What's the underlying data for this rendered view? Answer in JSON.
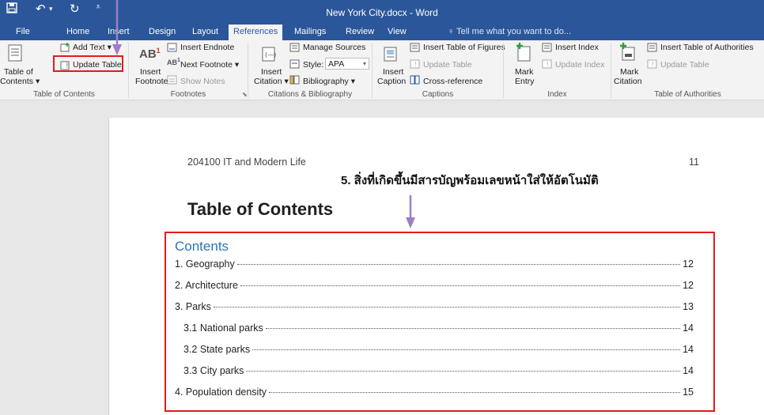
{
  "title_bar": {
    "doc_title": "New York City.docx - Word",
    "save_icon": "save-icon",
    "undo_icon": "undo-icon",
    "redo_icon": "redo-icon",
    "customize_icon": "customize-quick-access-icon"
  },
  "tabs": [
    {
      "label": "File"
    },
    {
      "label": "Home"
    },
    {
      "label": "Insert"
    },
    {
      "label": "Design"
    },
    {
      "label": "Layout"
    },
    {
      "label": "References",
      "active": true
    },
    {
      "label": "Mailings"
    },
    {
      "label": "Review"
    },
    {
      "label": "View"
    }
  ],
  "tell_me": {
    "placeholder": "Tell me what you want to do..."
  },
  "ribbon": {
    "toc": {
      "table_of_contents": "Table of",
      "table_of_contents_2": "Contents",
      "add_text": "Add Text",
      "update_table": "Update Table",
      "group_label": "Table of Contents"
    },
    "footnotes": {
      "insert_footnote": "Insert",
      "insert_footnote_2": "Footnote",
      "insert_endnote": "Insert Endnote",
      "next_footnote": "Next Footnote",
      "show_notes": "Show Notes",
      "group_label": "Footnotes"
    },
    "citations": {
      "insert_citation": "Insert",
      "insert_citation_2": "Citation",
      "manage_sources": "Manage Sources",
      "style_label": "Style:",
      "style_value": "APA",
      "bibliography": "Bibliography",
      "group_label": "Citations & Bibliography"
    },
    "captions": {
      "insert_caption": "Insert",
      "insert_caption_2": "Caption",
      "insert_table_of_figures": "Insert Table of Figures",
      "update_table": "Update Table",
      "cross_reference": "Cross-reference",
      "group_label": "Captions"
    },
    "index": {
      "mark_entry": "Mark",
      "mark_entry_2": "Entry",
      "insert_index": "Insert Index",
      "update_index": "Update Index",
      "group_label": "Index"
    },
    "authorities": {
      "mark_citation": "Mark",
      "mark_citation_2": "Citation",
      "insert_table_of_authorities": "Insert Table of Authorities",
      "update_table": "Update Table",
      "group_label": "Table of Authorities"
    }
  },
  "document": {
    "header_left": "204100 IT and Modern Life",
    "page_number": "11",
    "heading": "Table of Contents",
    "contents_heading": "Contents",
    "toc_entries": [
      {
        "text": "1. Geography",
        "page": "12"
      },
      {
        "text": "2. Architecture",
        "page": "12"
      },
      {
        "text": "3. Parks",
        "page": "13"
      },
      {
        "text": "3.1 National parks",
        "page": "14"
      },
      {
        "text": "3.2 State parks",
        "page": "14"
      },
      {
        "text": "3.3 City parks",
        "page": "14"
      },
      {
        "text": "4. Population density",
        "page": "15"
      }
    ]
  },
  "annotation": {
    "step5": "5. สิ่งที่เกิดขึ้นมีสารบัญพร้อมเลขหน้าใส่ให้อัตโนมัติ",
    "highlight_color": "#e31b1b",
    "arrow_color": "#9b7fc7"
  },
  "colors": {
    "word_blue": "#2b579a",
    "heading_blue": "#2e74b5"
  }
}
